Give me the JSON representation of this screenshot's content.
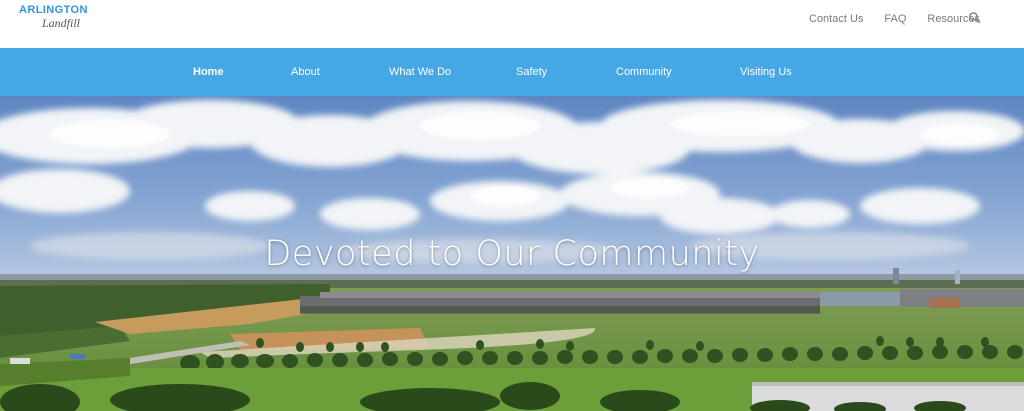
{
  "logo": {
    "line1": "ARLINGTON",
    "line2": "Landfill"
  },
  "utility_nav": [
    {
      "label": "Contact Us"
    },
    {
      "label": "FAQ"
    },
    {
      "label": "Resources"
    }
  ],
  "search": {
    "icon": "search-icon"
  },
  "main_nav": {
    "active": "Home",
    "items": [
      {
        "label": "Home"
      },
      {
        "label": "About"
      },
      {
        "label": "What We Do"
      },
      {
        "label": "Safety"
      },
      {
        "label": "Community"
      },
      {
        "label": "Visiting Us"
      }
    ]
  },
  "hero": {
    "headline": "Devoted to Our Community"
  },
  "colors": {
    "brand_blue": "#2e97d8",
    "nav_bar": "#45a7e4",
    "utility_text": "#7a7a7a"
  }
}
